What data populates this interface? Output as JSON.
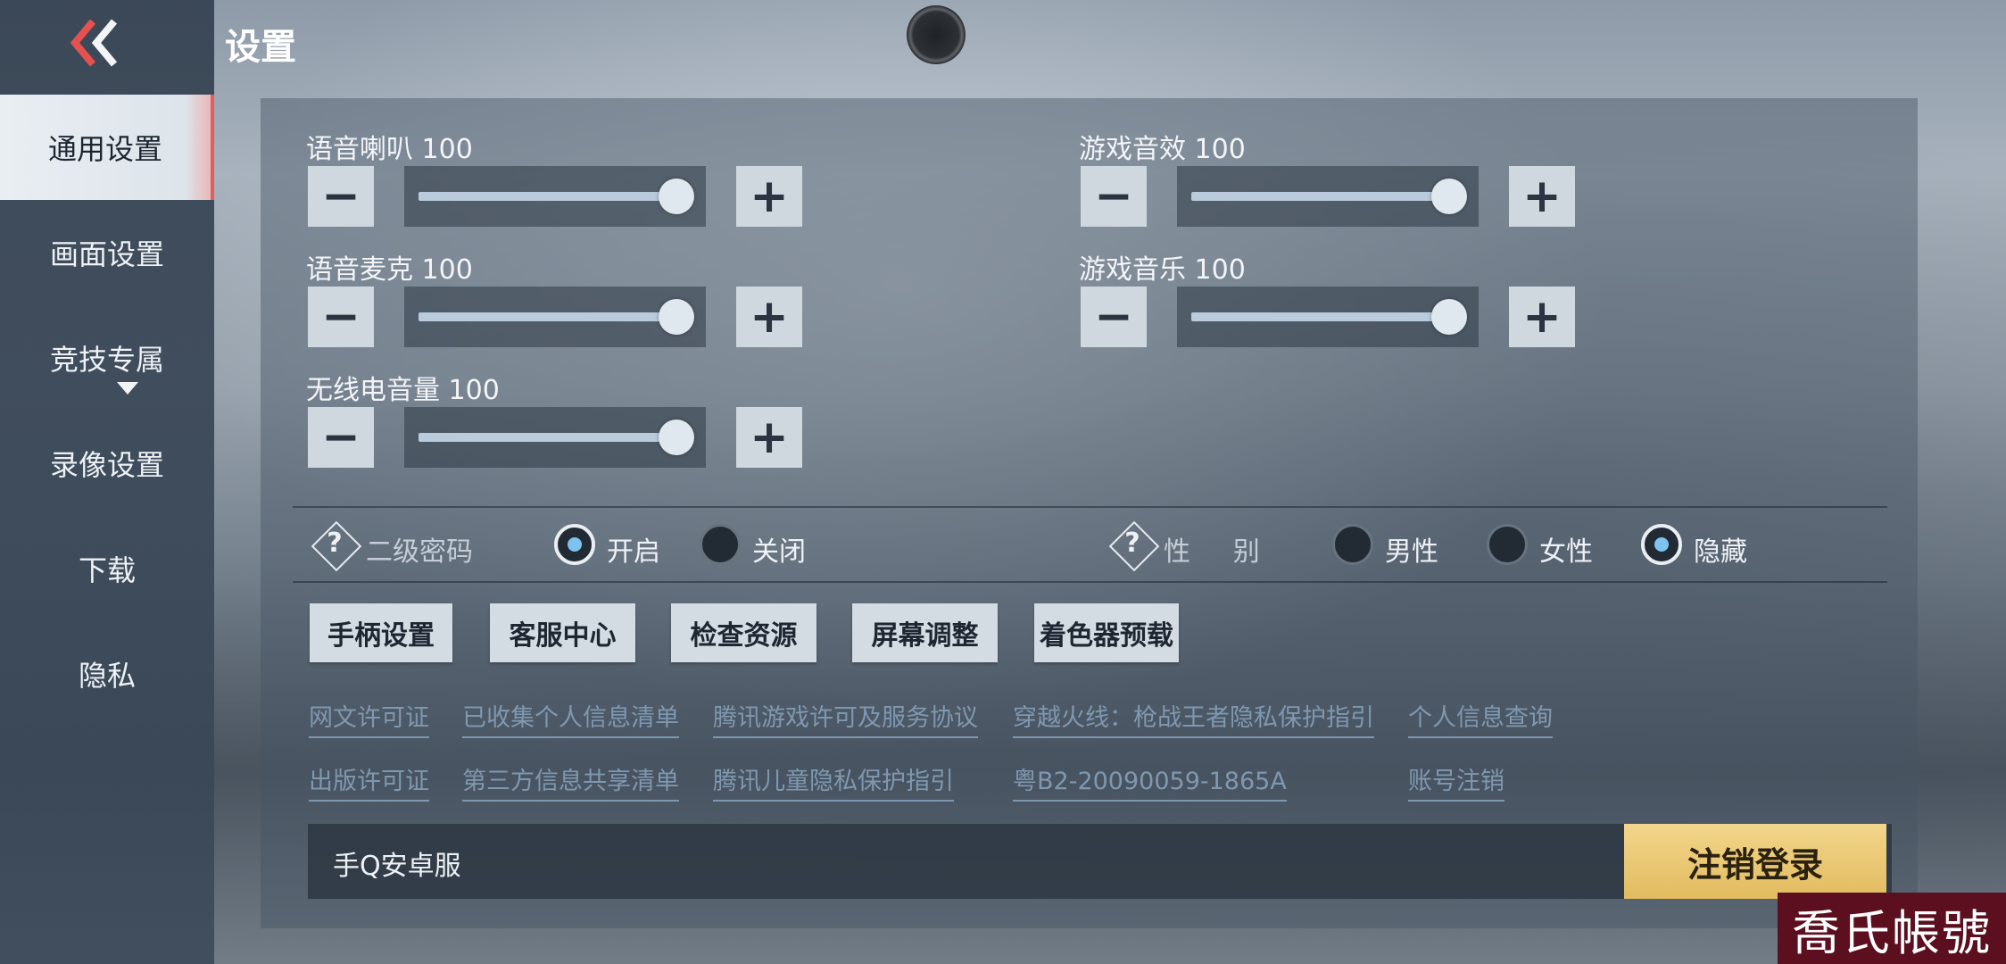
{
  "header": {
    "title": "设置"
  },
  "sidebar": {
    "items": [
      {
        "label": "通用设置",
        "active": true
      },
      {
        "label": "画面设置"
      },
      {
        "label": "竞技专属"
      },
      {
        "label": "录像设置"
      },
      {
        "label": "下载"
      },
      {
        "label": "隐私"
      }
    ]
  },
  "volume": {
    "speaker": {
      "label": "语音喇叭",
      "value": "100"
    },
    "sfx": {
      "label": "游戏音效",
      "value": "100"
    },
    "mic": {
      "label": "语音麦克",
      "value": "100"
    },
    "music": {
      "label": "游戏音乐",
      "value": "100"
    },
    "radio": {
      "label": "无线电音量",
      "value": "100"
    },
    "minus_glyph": "−",
    "plus_glyph": "+"
  },
  "options": {
    "help_glyph": "?",
    "secondary_password": {
      "label": "二级密码",
      "on": "开启",
      "off": "关闭",
      "selected": "开启"
    },
    "gender": {
      "label_a": "性",
      "label_b": "别",
      "male": "男性",
      "female": "女性",
      "hidden": "隐藏",
      "selected": "隐藏"
    }
  },
  "actions": [
    "手柄设置",
    "客服中心",
    "检查资源",
    "屏幕调整",
    "着色器预载"
  ],
  "links": {
    "row1": [
      "网文许可证",
      "已收集个人信息清单",
      "腾讯游戏许可及服务协议",
      "穿越火线：枪战王者隐私保护指引",
      "个人信息查询"
    ],
    "row2": [
      "出版许可证",
      "第三方信息共享清单",
      "腾讯儿童隐私保护指引",
      "粤B2-20090059-1865A",
      "账号注销"
    ]
  },
  "footer": {
    "server": "手Q安卓服",
    "logout": "注销登录"
  },
  "watermark": "喬氏帳號",
  "colors": {
    "accent_active": "#e65b5b",
    "logout_gold": "#e8c66f",
    "link": "#7f98b0",
    "radio_dot": "#7ec3f0"
  },
  "icons": {
    "back": "double-chevron-left-icon",
    "help": "question-diamond-icon"
  }
}
